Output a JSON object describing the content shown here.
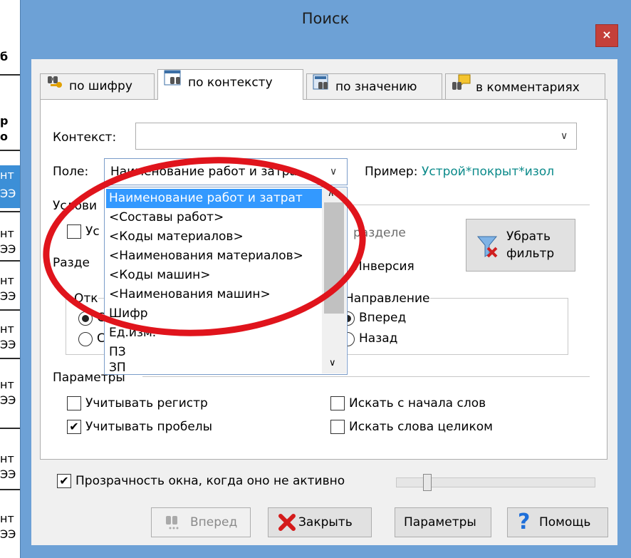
{
  "background_fragments": [
    "б",
    "р",
    "о",
    "нт",
    "ЭЭ",
    "нт",
    "ЭЭ",
    "нт",
    "ЭЭ",
    "нт",
    "ЭЭ",
    "нт",
    "ЭЭ",
    "нт",
    "ЭЭ",
    "нт",
    "ЭЭ"
  ],
  "window": {
    "title": "Поиск",
    "close_glyph": "×"
  },
  "tabs": [
    {
      "label": "по шифру",
      "icon": "binoculars-key-icon"
    },
    {
      "label": "по контексту",
      "icon": "binoculars-doc-icon",
      "active": true
    },
    {
      "label": "по значению",
      "icon": "binoculars-calc-icon"
    },
    {
      "label": "в комментариях",
      "icon": "binoculars-comment-icon"
    }
  ],
  "context": {
    "label": "Контекст:",
    "value": ""
  },
  "field": {
    "label": "Поле:",
    "value": "Наименование работ и затра",
    "example_label": "Пример:",
    "example_value": "Устрой*покрыт*изол"
  },
  "conditions": {
    "group_label": "Услови",
    "checkbox_label_partial": "Ус",
    "section_partial": "разделе",
    "razdel_partial": "Разде",
    "inversion_label": "Инверсия",
    "start_partial": "Отк",
    "radio1_partial": "С",
    "radio2_partial": "С"
  },
  "clear_filter": {
    "line1": "Убрать",
    "line2": "фильтр"
  },
  "direction": {
    "label": "Направление",
    "forward": "Вперед",
    "back": "Назад"
  },
  "dropdown": {
    "items": [
      "Наименование работ и затрат",
      "<Составы работ>",
      "<Коды материалов>",
      "<Наименования материалов>",
      "<Коды машин>",
      "<Наименования машин>",
      "Шифр",
      "Ед.изм.",
      "ПЗ",
      "ЗП"
    ],
    "selected_index": 0
  },
  "params": {
    "group_label": "Параметры",
    "case": {
      "label": "Учитывать регистр",
      "checked": false
    },
    "spaces": {
      "label": "Учитывать пробелы",
      "checked": true
    },
    "word_start": {
      "label": "Искать с начала слов",
      "checked": false
    },
    "whole_word": {
      "label": "Искать слова целиком",
      "checked": false
    }
  },
  "transparency": {
    "label": "Прозрачность окна, когда оно не активно",
    "checked": true,
    "level": 0.14
  },
  "buttons": {
    "forward": "Вперед",
    "close": "Закрыть",
    "params": "Параметры",
    "help": "Помощь"
  },
  "colors": {
    "window_frame": "#6da1d6",
    "close_button": "#c4403a",
    "selection": "#3399ff",
    "annotation": "#e0141c",
    "example_text": "#0b8a8a"
  }
}
